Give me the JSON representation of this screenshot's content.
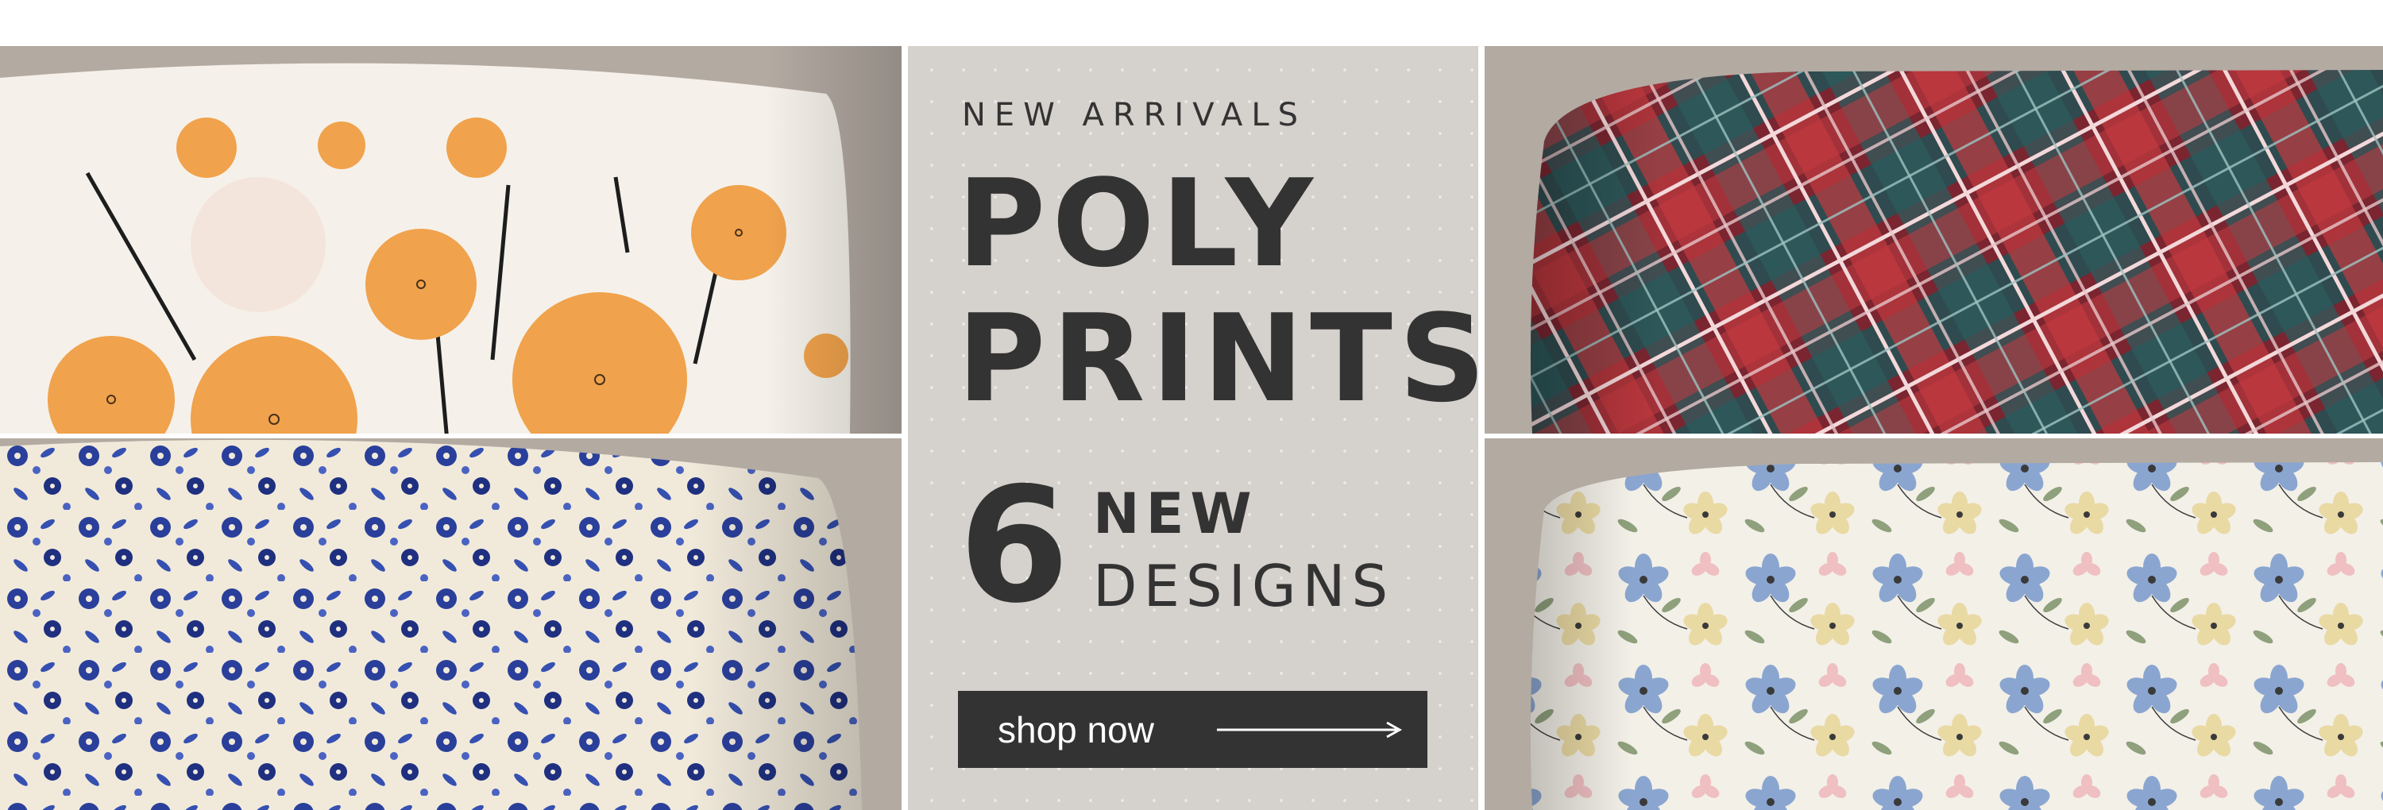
{
  "promo": {
    "eyebrow": "NEW ARRIVALS",
    "headline_line1": "POLY",
    "headline_line2": "PRINTS",
    "count": "6",
    "count_word1": "NEW",
    "count_word2": "DESIGNS",
    "cta_label": "shop now"
  },
  "icons": {
    "cta_arrow": "arrow-right-icon"
  },
  "colors": {
    "panel_background": "#d5d1cc",
    "text": "#333333",
    "button_background": "#333333",
    "button_text": "#ffffff",
    "photo_backdrop": "#b3aaa2"
  }
}
